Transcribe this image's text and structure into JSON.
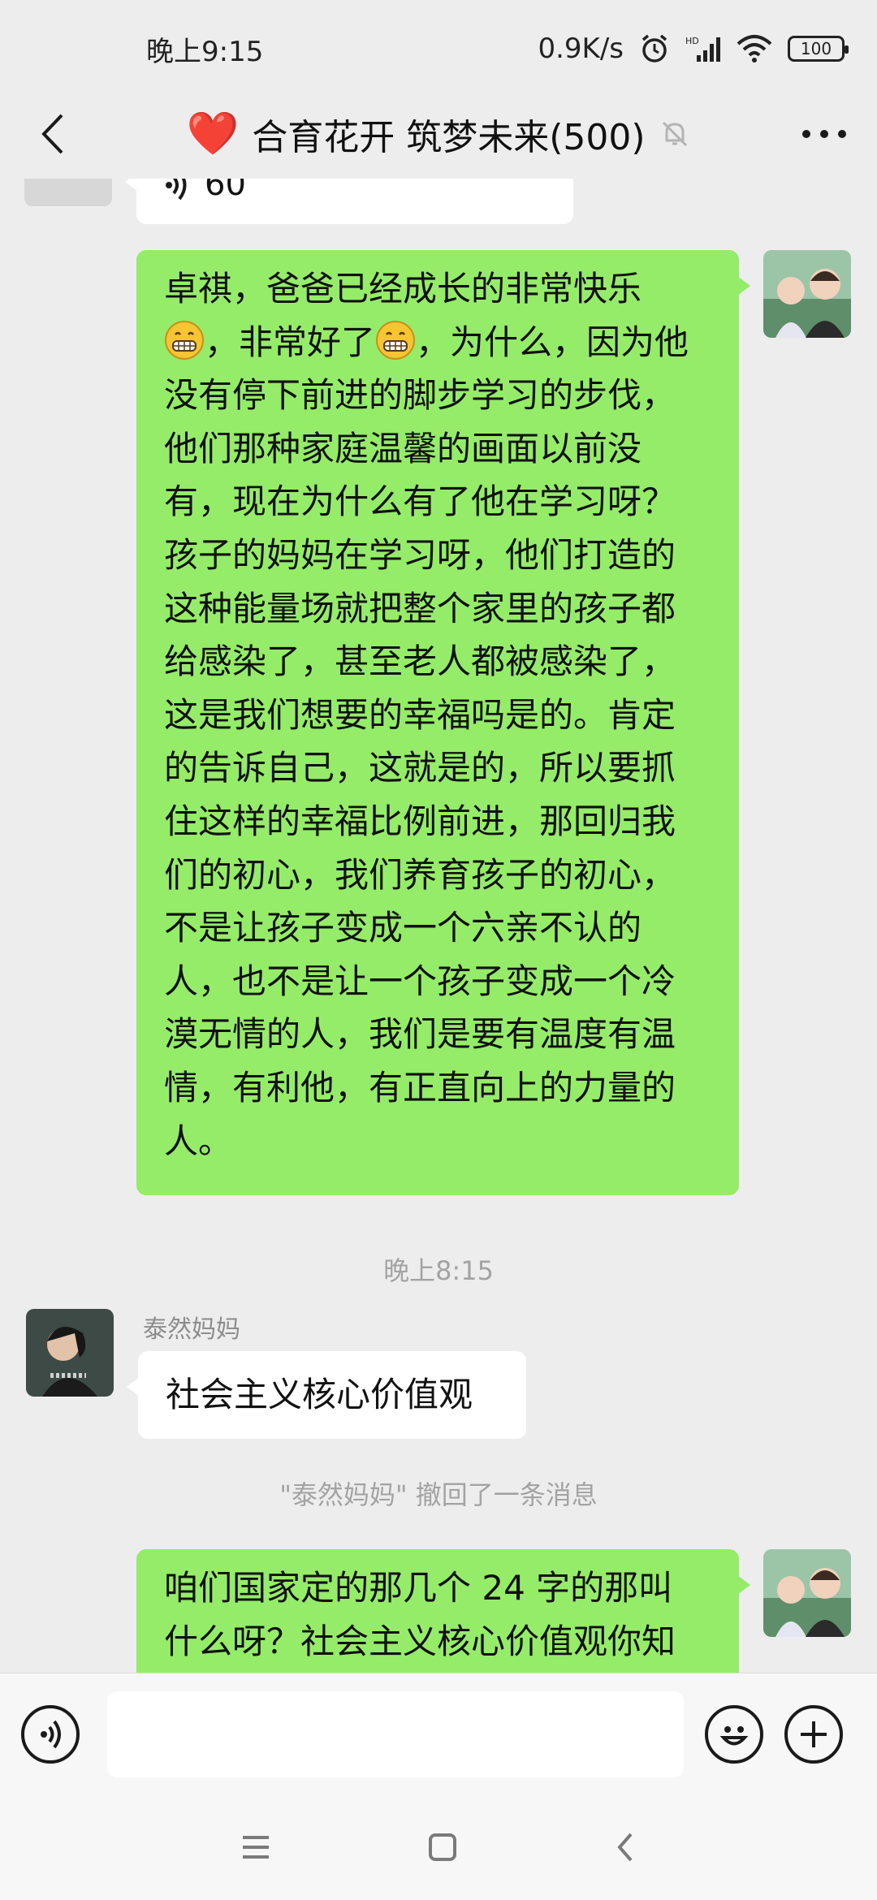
{
  "status_bar": {
    "time": "晚上9:15",
    "net_speed": "0.9K/s",
    "battery": "100"
  },
  "header": {
    "title": "合育花开 筑梦未来(500)",
    "heart_emoji": "❤️"
  },
  "messages": {
    "partial_voice": {
      "duration": "60"
    },
    "long_msg": {
      "lines": [
        "卓祺，爸爸已经成长的非常快乐",
        "，非常好了",
        "，为什么，因为他",
        "没有停下前进的脚步学习的步伐，",
        "他们那种家庭温馨的画面以前没",
        "有，现在为什么有了他在学习呀？",
        "孩子的妈妈在学习呀，他们打造的",
        "这种能量场就把整个家里的孩子都",
        "给感染了，甚至老人都被感染了，",
        "这是我们想要的幸福吗是的。肯定",
        "的告诉自己，这就是的，所以要抓",
        "住这样的幸福比例前进，那回归我",
        "们的初心，我们养育孩子的初心，",
        "不是让孩子变成一个六亲不认的",
        "人，也不是让一个孩子变成一个冷",
        "漠无情的人，我们是要有温度有温",
        "情，有利他，有正直向上的力量的",
        "人。"
      ]
    },
    "timestamp": "晚上8:15",
    "incoming": {
      "sender": "泰然妈妈",
      "text": "社会主义核心价值观"
    },
    "recall_notice": "\"泰然妈妈\" 撤回了一条消息",
    "last_msg": {
      "lines": [
        "咱们国家定的那几个 24 字的那叫",
        "什么呀？社会主义核心价值观你知"
      ]
    }
  },
  "icons": {
    "back": "back-arrow-icon",
    "more": "more-icon",
    "mute": "mute-bell-icon",
    "voice": "voice-icon",
    "emoji": "emoji-icon",
    "plus": "plus-icon"
  },
  "colors": {
    "sent_bubble": "#95ec69",
    "received_bubble": "#ffffff",
    "background": "#ededed"
  }
}
